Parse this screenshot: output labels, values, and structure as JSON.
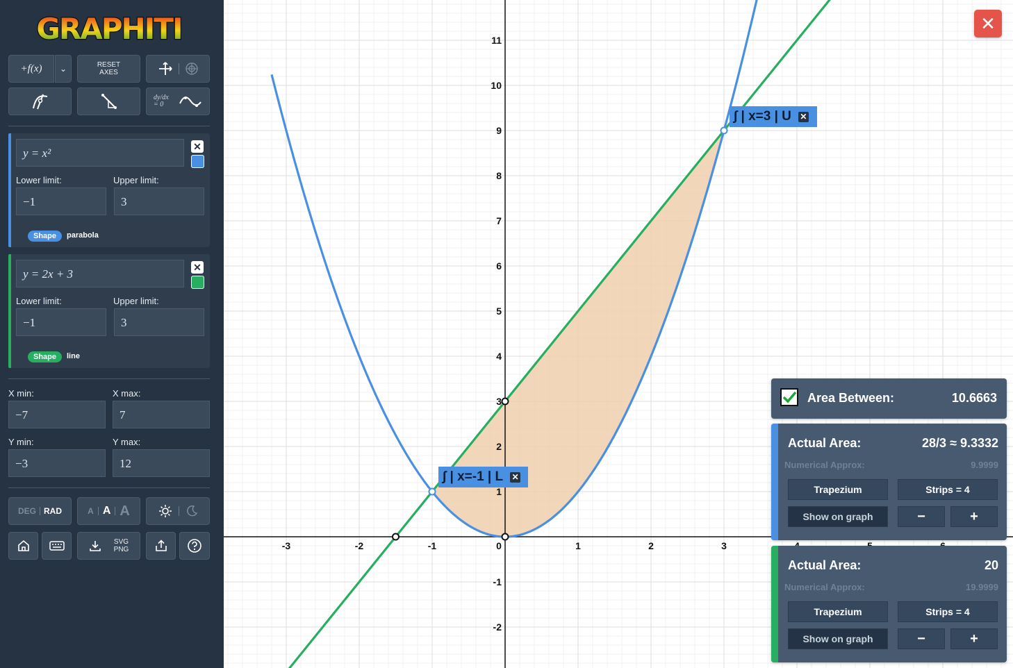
{
  "app": {
    "logo": "GRAPHITI"
  },
  "toolbar": {
    "add_function_label": "+f(x)",
    "reset_axes_label": "RESET AXES",
    "deriv_label": "dy/dx = 0"
  },
  "functions": [
    {
      "equation": "y = x²",
      "lower_label": "Lower limit:",
      "lower": "−1",
      "upper_label": "Upper limit:",
      "upper": "3",
      "shape_label": "Shape",
      "shape": "parabola",
      "color": "#4a90e2",
      "close": "✕"
    },
    {
      "equation": "y = 2x + 3",
      "lower_label": "Lower limit:",
      "lower": "−1",
      "upper_label": "Upper limit:",
      "upper": "3",
      "shape_label": "Shape",
      "shape": "line",
      "color": "#27ae60",
      "close": "✕"
    }
  ],
  "axes": {
    "xmin_label": "X min:",
    "xmin": "−7",
    "xmax_label": "X max:",
    "xmax": "7",
    "ymin_label": "Y min:",
    "ymin": "−3",
    "ymax_label": "Y max:",
    "ymax": "12"
  },
  "settings": {
    "deg": "DEG",
    "rad": "RAD",
    "font_small": "A",
    "font_medium": "A",
    "font_large": "A",
    "export_svg": "SVG",
    "export_png": "PNG"
  },
  "graph": {
    "x_ticks": [
      "-3",
      "-2",
      "-1",
      "0",
      "1",
      "2",
      "3",
      "4",
      "5",
      "6"
    ],
    "y_ticks": [
      "-2",
      "-1",
      "1",
      "2",
      "3",
      "4",
      "5",
      "6",
      "7",
      "8",
      "9",
      "10",
      "11"
    ],
    "label_lower": "∫ | x=-1 | L",
    "label_upper": "∫ | x=3 | U",
    "label_close": "✕",
    "fill_color": "#f0cfad",
    "parabola_color": "#4a90e2",
    "line_color": "#27ae60"
  },
  "results": {
    "close": "✕",
    "area_between": {
      "checked": true,
      "label": "Area Between:",
      "value": "10.6663"
    },
    "panels": [
      {
        "title": "Actual Area:",
        "value": "28/3 ≈ 9.3332",
        "approx_label": "Numerical Approx:",
        "approx_value": "9.9999",
        "method": "Trapezium",
        "strips": "Strips = 4",
        "show": "Show on graph",
        "minus": "−",
        "plus": "+",
        "color": "#4a90e2"
      },
      {
        "title": "Actual Area:",
        "value": "20",
        "approx_label": "Numerical Approx:",
        "approx_value": "19.9999",
        "method": "Trapezium",
        "strips": "Strips = 4",
        "show": "Show on graph",
        "minus": "−",
        "plus": "+",
        "color": "#27ae60"
      }
    ]
  }
}
